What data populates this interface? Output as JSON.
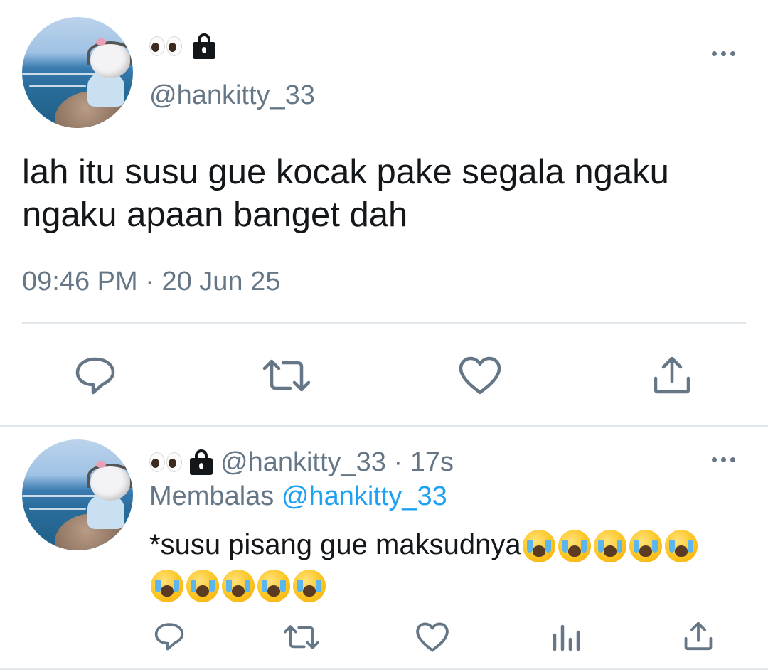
{
  "tweet": {
    "name_emoji": "👀",
    "handle": "@hankitty_33",
    "text": "lah itu susu gue kocak pake segala ngaku ngaku apaan banget dah",
    "time": "09:46 PM",
    "separator": "·",
    "date": "20 Jun 25",
    "icons": {
      "more": "more-icon",
      "lock": "lock-icon",
      "reply": "reply-icon",
      "retweet": "retweet-icon",
      "like": "heart-icon",
      "share": "share-icon"
    }
  },
  "reply": {
    "name_emoji": "👀",
    "handle": "@hankitty_33",
    "separator": "·",
    "age": "17s",
    "replying_label": "Membalas",
    "replying_to": "@hankitty_33",
    "text_line1": "*susu pisang gue maksudnya",
    "emoji_count_line1": 5,
    "emoji_count_line2": 5,
    "emoji": "😭",
    "icons": {
      "more": "more-icon",
      "reply": "reply-icon",
      "retweet": "retweet-icon",
      "like": "heart-icon",
      "analytics": "analytics-icon",
      "share": "share-icon"
    }
  },
  "colors": {
    "text": "#14171a",
    "secondary": "#657786",
    "link": "#1da1f2",
    "divider": "#e1e8ed"
  }
}
